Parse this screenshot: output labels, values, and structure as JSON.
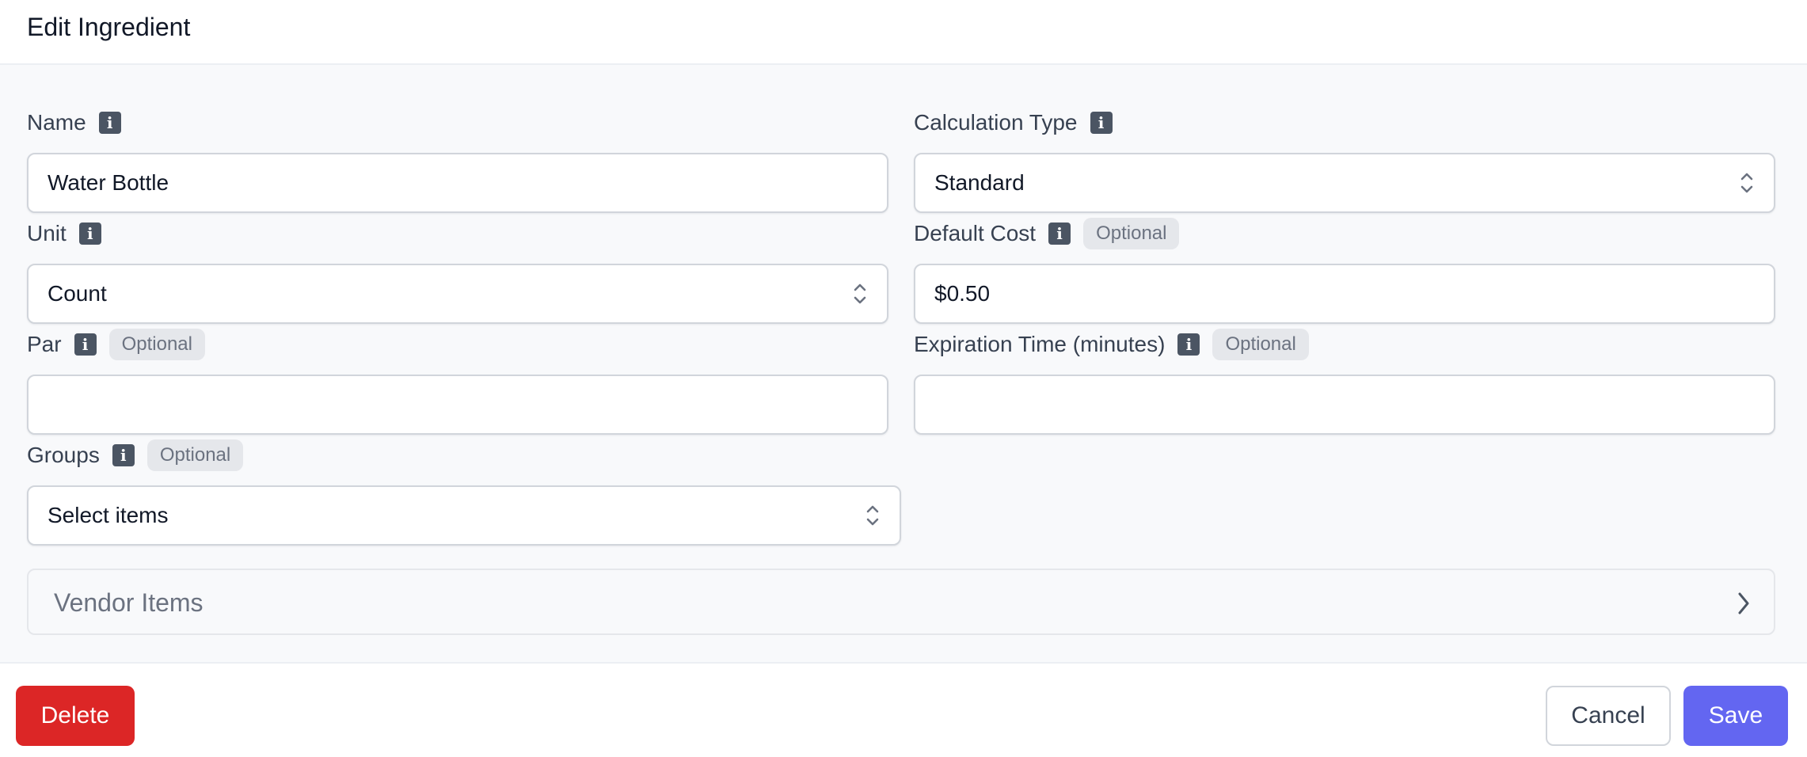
{
  "header": {
    "title": "Edit Ingredient"
  },
  "form": {
    "name": {
      "label": "Name",
      "value": "Water Bottle"
    },
    "calculation_type": {
      "label": "Calculation Type",
      "value": "Standard"
    },
    "unit": {
      "label": "Unit",
      "value": "Count"
    },
    "default_cost": {
      "label": "Default Cost",
      "badge": "Optional",
      "value": "$0.50"
    },
    "par": {
      "label": "Par",
      "badge": "Optional",
      "value": ""
    },
    "expiration_time": {
      "label": "Expiration Time (minutes)",
      "badge": "Optional",
      "value": ""
    },
    "groups": {
      "label": "Groups",
      "badge": "Optional",
      "placeholder": "Select items"
    }
  },
  "vendor_items": {
    "title": "Vendor Items"
  },
  "footer": {
    "delete_label": "Delete",
    "cancel_label": "Cancel",
    "save_label": "Save"
  },
  "icons": {
    "info": "info-icon",
    "select": "chevron-up-down-icon",
    "expand": "chevron-right-icon"
  },
  "colors": {
    "delete": "#dc2626",
    "save": "#6366f1",
    "info_icon": "#4b5563",
    "badge_bg": "#e5e7eb",
    "body_bg": "#f8f9fb"
  }
}
